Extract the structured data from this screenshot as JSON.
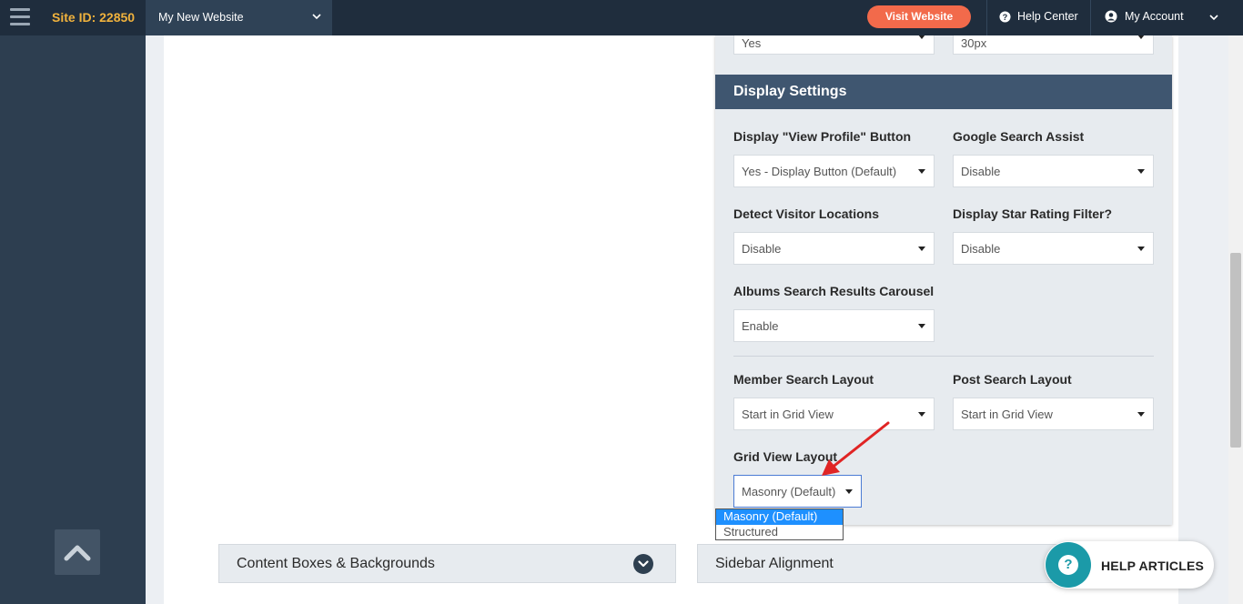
{
  "topbar": {
    "site_id": "Site ID: 22850",
    "site_name": "My New Website",
    "visit_label": "Visit Website",
    "help_label": "Help Center",
    "account_label": "My Account"
  },
  "panel": {
    "top_left_value": "Yes",
    "top_right_value": "30px",
    "header": "Display Settings",
    "fields": [
      {
        "label": "Display \"View Profile\" Button",
        "value": "Yes - Display Button (Default)"
      },
      {
        "label": "Google Search Assist",
        "value": "Disable"
      },
      {
        "label": "Detect Visitor Locations",
        "value": "Disable"
      },
      {
        "label": "Display Star Rating Filter?",
        "value": "Disable"
      },
      {
        "label": "Albums Search Results Carousel",
        "value": "Enable"
      },
      {
        "label": "Member Search Layout",
        "value": "Start in Grid View"
      },
      {
        "label": "Post Search Layout",
        "value": "Start in Grid View"
      },
      {
        "label": "Grid View Layout",
        "value": "Masonry (Default)"
      }
    ],
    "grid_options": [
      "Masonry (Default)",
      "Structured"
    ]
  },
  "accordions": {
    "left": "Content Boxes & Backgrounds",
    "right": "Sidebar Alignment"
  },
  "help_widget": {
    "label": "HELP ARTICLES",
    "icon_char": "?"
  },
  "colors": {
    "topbar": "#1f2d3d",
    "sidebar": "#2d3e50",
    "site_id": "#f0b23d",
    "visit_button": "#f26a4b",
    "panel_header": "#3f5670",
    "selected_option": "#1e90ff",
    "help_icon": "#1b9aa8",
    "annotation_arrow": "#e02424"
  }
}
